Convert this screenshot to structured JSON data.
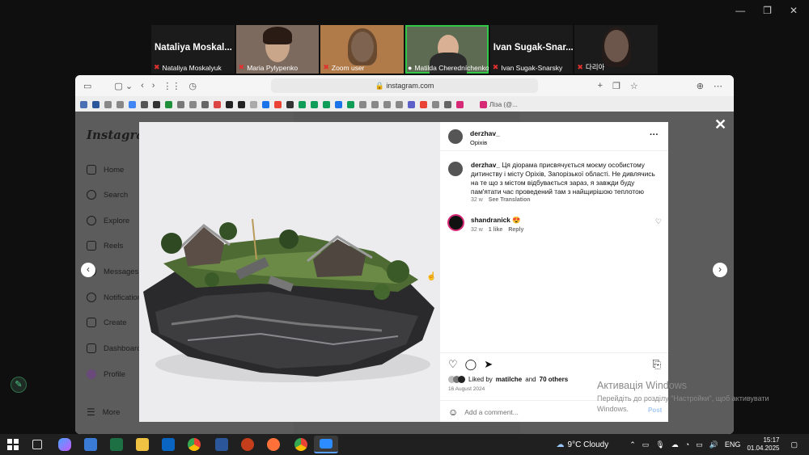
{
  "zoom": {
    "participants": [
      {
        "bigname": "Nataliya  Moskal...",
        "label": "Nataliya Moskalyuk",
        "video": false
      },
      {
        "label": "Maria Pylypenko",
        "video": true
      },
      {
        "label": "Zoom user",
        "video": true
      },
      {
        "label": "Matilda Cheredníchenko",
        "video": true,
        "active": true
      },
      {
        "bigname": "Ivan  Sugak-Snar...",
        "label": "Ivan Sugak-Snarsky",
        "video": false
      },
      {
        "label": "다리아",
        "video": true
      }
    ]
  },
  "browser": {
    "url": "instagram.com",
    "bookmark_last": "Ліза (@..."
  },
  "instagram": {
    "logo": "Instagram",
    "nav": [
      "Home",
      "Search",
      "Explore",
      "Reels",
      "Messages",
      "Notifications",
      "Create",
      "Dashboard",
      "Profile",
      "More"
    ],
    "post": {
      "author": "derzhav_",
      "location": "Оріхів",
      "caption_author": "derzhav_",
      "caption": "Ця діорама присвячується моєму особистому дитинству і місту Оріхів, Запорізької області. Не дивлячись на те що з містом відбувається зараз, я завжди буду пам'ятати час проведений там з найщирішою теплотою",
      "caption_age": "32 w",
      "see_translation": "See Translation",
      "comment_user": "shandranick",
      "comment_text": "😍",
      "comment_age": "32 w",
      "comment_likes": "1 like",
      "reply": "Reply",
      "liked_by_prefix": "Liked by",
      "liked_by_user": "matilche",
      "liked_by_and": "and",
      "liked_by_others": "70 others",
      "date": "16 August 2024",
      "add_comment_placeholder": "Add a comment...",
      "post_label": "Post"
    }
  },
  "watermark": {
    "title": "Активація Windows",
    "line": "Перейдіть до розділу \"Настройки\", щоб активувати Windows."
  },
  "taskbar": {
    "weather": "9°C  Cloudy",
    "lang": "ENG",
    "time": "15:17",
    "date": "01.04.2025"
  }
}
